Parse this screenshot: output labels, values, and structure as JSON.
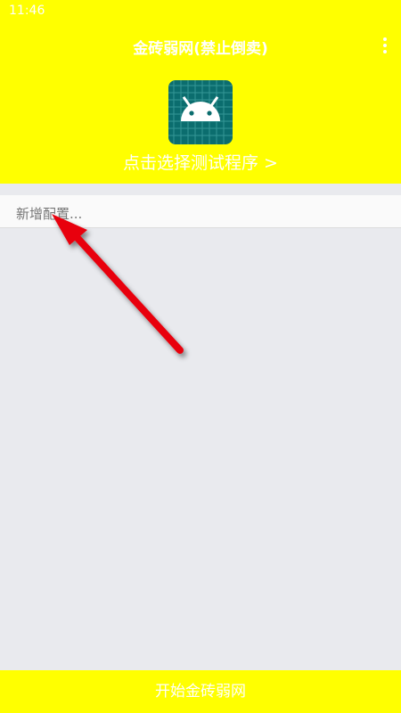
{
  "status_bar": {
    "time": "11:46"
  },
  "header": {
    "title": "金砖弱网(禁止倒卖)",
    "menu_icon": "more-vert-icon",
    "app_icon": "android-icon",
    "select_label": "点击选择测试程序 >"
  },
  "config": {
    "add_label": "新增配置..."
  },
  "annotation": {
    "arrow_color": "#e8000b"
  },
  "footer": {
    "start_label": "开始金砖弱网"
  },
  "colors": {
    "accent": "#ffff00",
    "text_on_accent": "#ffffff",
    "icon_bg": "#0b6d6e"
  }
}
